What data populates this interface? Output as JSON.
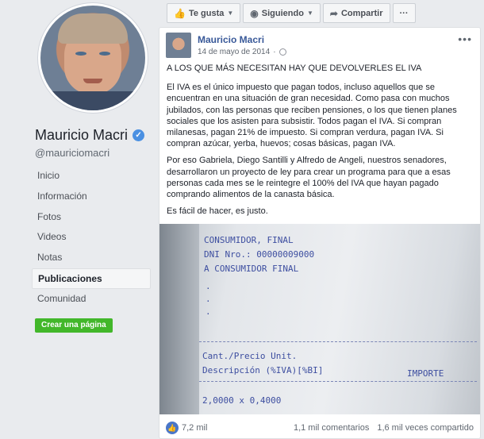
{
  "profile": {
    "name": "Mauricio Macri",
    "handle": "@mauriciomacri",
    "verified_icon": "verified-badge-icon"
  },
  "nav": {
    "items": [
      {
        "label": "Inicio"
      },
      {
        "label": "Información"
      },
      {
        "label": "Fotos"
      },
      {
        "label": "Videos"
      },
      {
        "label": "Notas"
      },
      {
        "label": "Publicaciones",
        "active": true
      },
      {
        "label": "Comunidad"
      }
    ],
    "create_page": "Crear una página"
  },
  "actions": {
    "like": "Te gusta",
    "following": "Siguiendo",
    "share": "Compartir",
    "more": "···"
  },
  "post": {
    "author": "Mauricio Macri",
    "date": "14 de mayo de 2014",
    "headline": "A LOS QUE MÁS NECESITAN HAY QUE DEVOLVERLES EL IVA",
    "p1": "El IVA es el único impuesto que pagan todos, incluso aquellos que se encuentran en una situación de gran necesidad. Como pasa con muchos jubilados, con las personas que reciben pensiones, o los que tienen planes sociales que los asisten para subsistir. Todos pagan el IVA. Si compran milanesas, pagan 21% de impuesto. Si compran verdura, pagan IVA. Si compran azúcar, yerba, huevos; cosas básicas, pagan IVA.",
    "p2": "Por eso Gabriela, Diego Santilli y Alfredo de Angeli, nuestros senadores, desarrollaron un proyecto de ley para crear un programa para que a esas personas cada mes se le reintegre el 100% del IVA que hayan pagado comprando alimentos de la canasta básica.",
    "p3": "Es fácil de hacer, es justo.",
    "receipt": {
      "l1": "CONSUMIDOR, FINAL",
      "l2": "DNI Nro.: 00000009000",
      "l3": "A CONSUMIDOR FINAL",
      "l4": "Cant./Precio Unit.",
      "l5": "Descripción (%IVA)[%BI]",
      "l5b": "IMPORTE",
      "l6": "2,0000 x 0,4000"
    },
    "likes": "7,2 mil",
    "comments": "1,1 mil comentarios",
    "shares": "1,6 mil veces compartido"
  },
  "colors": {
    "link": "#385898",
    "create_button": "#42b72a",
    "background": "#e9ebee"
  }
}
